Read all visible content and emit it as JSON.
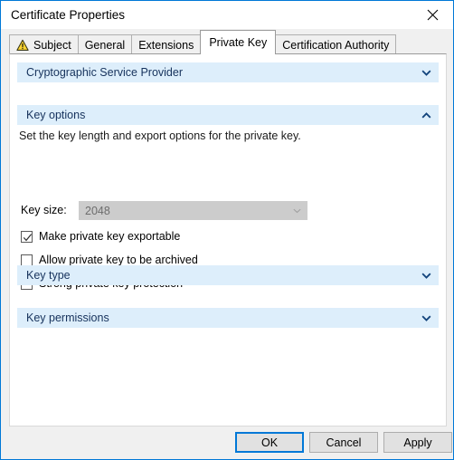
{
  "window": {
    "title": "Certificate Properties",
    "close_icon": "close-icon"
  },
  "tabs": [
    {
      "label": "Subject",
      "icon": "warning-triangle-icon",
      "active": false
    },
    {
      "label": "General",
      "icon": "",
      "active": false
    },
    {
      "label": "Extensions",
      "icon": "",
      "active": false
    },
    {
      "label": "Private Key",
      "icon": "",
      "active": true
    },
    {
      "label": "Certification Authority",
      "icon": "",
      "active": false
    }
  ],
  "sections": {
    "csp": {
      "title": "Cryptographic Service Provider",
      "state": "collapsed",
      "chevron": "chevron-down-icon"
    },
    "key_options": {
      "title": "Key options",
      "state": "expanded",
      "chevron": "chevron-up-icon",
      "description": "Set the key length and export options for the private key.",
      "key_size": {
        "label": "Key size:",
        "value": "2048",
        "disabled": true,
        "arrow": "chevron-down-icon"
      },
      "checkboxes": [
        {
          "label": "Make private key exportable",
          "checked": true
        },
        {
          "label": "Allow private key to be archived",
          "checked": false
        },
        {
          "label": "Strong private key protection",
          "checked": false
        }
      ]
    },
    "key_type": {
      "title": "Key type",
      "state": "collapsed",
      "chevron": "chevron-down-icon"
    },
    "key_permissions": {
      "title": "Key permissions",
      "state": "collapsed",
      "chevron": "chevron-down-icon"
    }
  },
  "buttons": {
    "ok": "OK",
    "cancel": "Cancel",
    "apply": "Apply"
  },
  "colors": {
    "window_border": "#0078d7",
    "section_header_bg": "#ddeefb",
    "section_header_text": "#16325c",
    "chevron": "#14457d",
    "default_button_border": "#0078d7",
    "warning_yellow": "#ffd531",
    "disabled_text": "#6d6d6d"
  }
}
